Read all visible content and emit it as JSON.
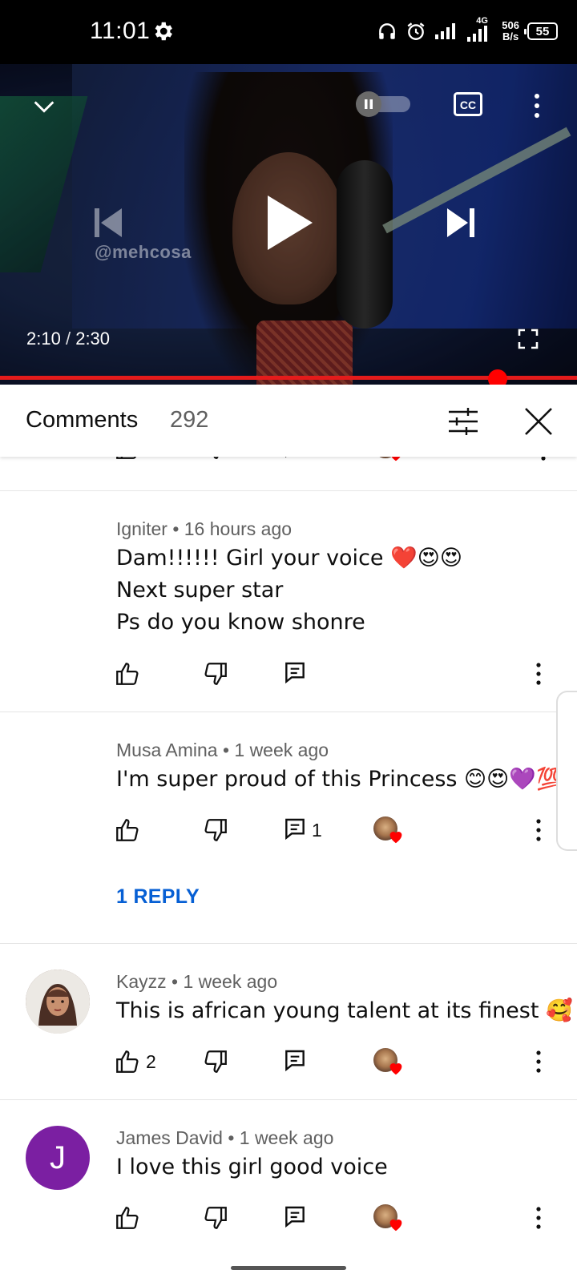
{
  "status_bar": {
    "time": "11:01",
    "network_type": "4G",
    "speed_value": "506",
    "speed_unit": "B/s",
    "battery": "55"
  },
  "player": {
    "watermark": "@mehcosa",
    "current_time": "2:10",
    "time_separator": "/",
    "duration": "2:30",
    "progress": 0.87,
    "cc_label": "CC"
  },
  "comments_header": {
    "title": "Comments",
    "count": "292"
  },
  "comments": [
    {
      "author_meta": "Igniter • 16 hours ago",
      "lines": [
        "Dam!!!!!! Girl your voice ❤️😍😍",
        "Next super star",
        "Ps do you know shonre"
      ],
      "likes": "",
      "replies_count": "",
      "creator_heart": false
    },
    {
      "author_meta": "Musa Amina • 1 week ago",
      "lines": [
        "I'm super proud of this Princess 😊😍💜💯"
      ],
      "likes": "",
      "replies_count": "1",
      "creator_heart": true,
      "reply_link": "1 REPLY"
    },
    {
      "author_meta": "Kayzz • 1 week ago",
      "lines": [
        "This is african young talent at its finest 🥰"
      ],
      "likes": "2",
      "replies_count": "",
      "creator_heart": true
    },
    {
      "author_meta": "James David • 1 week ago",
      "avatar_letter": "J",
      "lines": [
        "I love this girl good voice"
      ],
      "likes": "",
      "replies_count": "",
      "creator_heart": true
    }
  ],
  "colors": {
    "progress_red": "#ff0000",
    "link_blue": "#065fd4",
    "avatar_purple": "#7b1fa2",
    "heart_red": "#ff0000"
  }
}
